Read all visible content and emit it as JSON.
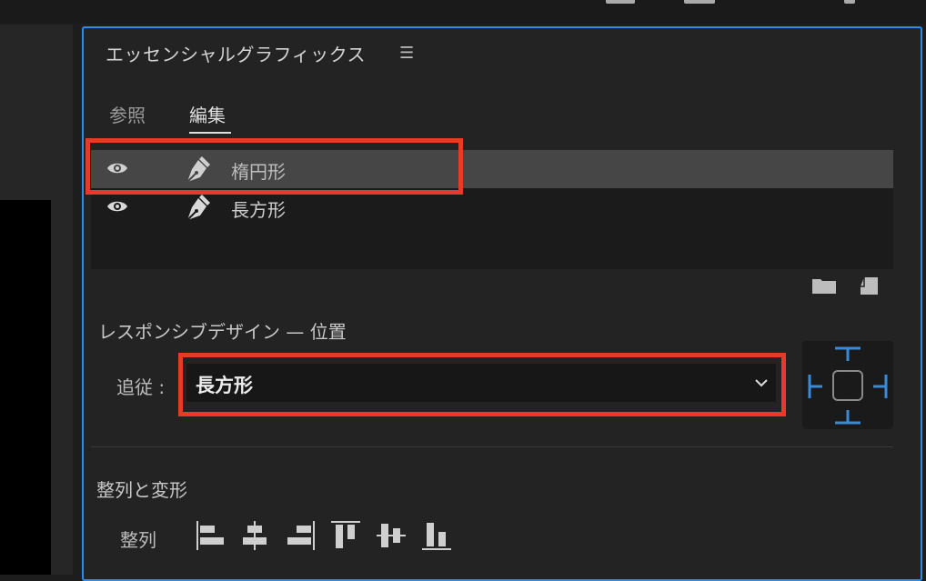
{
  "panel": {
    "title": "エッセンシャルグラフィックス",
    "menu_glyph": "☰",
    "tabs": [
      {
        "label": "参照",
        "active": false
      },
      {
        "label": "編集",
        "active": true
      }
    ]
  },
  "layers": [
    {
      "name": "楕円形",
      "selected": true,
      "visible": true,
      "icon": "pen-icon"
    },
    {
      "name": "長方形",
      "selected": false,
      "visible": true,
      "icon": "pen-icon"
    }
  ],
  "layer_actions": [
    "folder-icon",
    "new-item-icon"
  ],
  "responsive_design": {
    "heading": "レスポンシブデザイン — 位置",
    "follow_label": "追従 :",
    "follow_value": "長方形"
  },
  "align": {
    "heading": "整列と変形",
    "label": "整列",
    "buttons": [
      "align-left-icon",
      "align-center-horizontal-icon",
      "align-right-icon",
      "align-top-icon",
      "align-center-vertical-icon",
      "align-bottom-icon"
    ]
  },
  "colors": {
    "panel_focus_border": "#2d8ceb",
    "annotation_red": "#e8392a",
    "pin_blue": "#3a8ad8"
  }
}
